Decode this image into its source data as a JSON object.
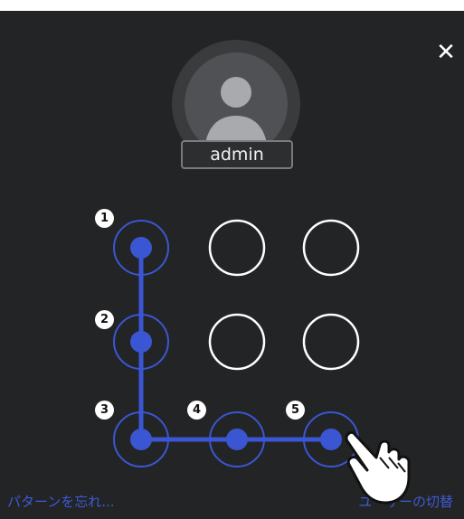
{
  "dialog": {
    "close_glyph": "✕",
    "username": "admin"
  },
  "pattern": {
    "grid_size": 3,
    "sequence": [
      [
        0,
        0
      ],
      [
        1,
        0
      ],
      [
        2,
        0
      ],
      [
        2,
        1
      ],
      [
        2,
        2
      ]
    ],
    "step_labels": [
      "1",
      "2",
      "3",
      "4",
      "5"
    ],
    "active_color": "#3b56d3",
    "inactive_color": "#ffffff"
  },
  "footer": {
    "forgot_label": "パターンを忘れ...",
    "switch_user_label": "ユーザーの切替"
  },
  "colors": {
    "background": "#232425",
    "link": "#3d5bd8"
  }
}
